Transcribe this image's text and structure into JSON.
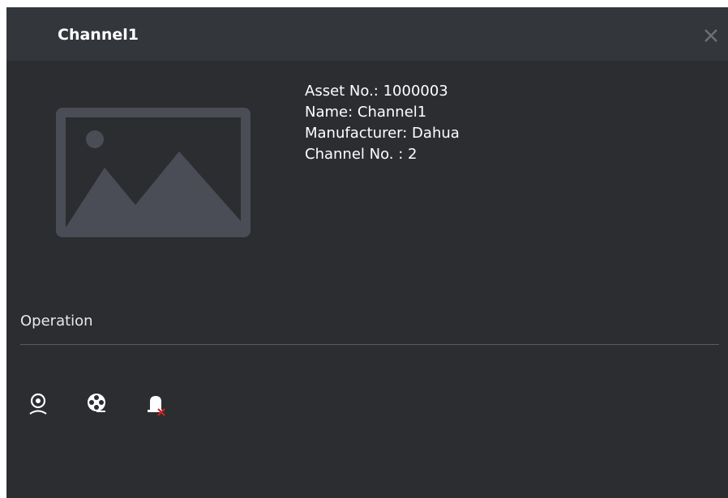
{
  "dialog": {
    "title": "Channel1",
    "close_icon": "close-icon"
  },
  "info": {
    "asset_no": "Asset No.: 1000003",
    "name": "Name: Channel1",
    "manufacturer": "Manufacturer: Dahua",
    "channel_no": "Channel No. : 2"
  },
  "thumbnail": {
    "icon": "image-placeholder-icon"
  },
  "operation": {
    "label": "Operation",
    "buttons": [
      {
        "icon": "live-view-icon"
      },
      {
        "icon": "playback-icon"
      },
      {
        "icon": "alarm-disarm-icon"
      }
    ]
  },
  "colors": {
    "background": "#2b2d31",
    "titlebar": "#33363b",
    "text": "#ffffff",
    "placeholder": "#4a4d55",
    "accent_red": "#cc2222"
  }
}
